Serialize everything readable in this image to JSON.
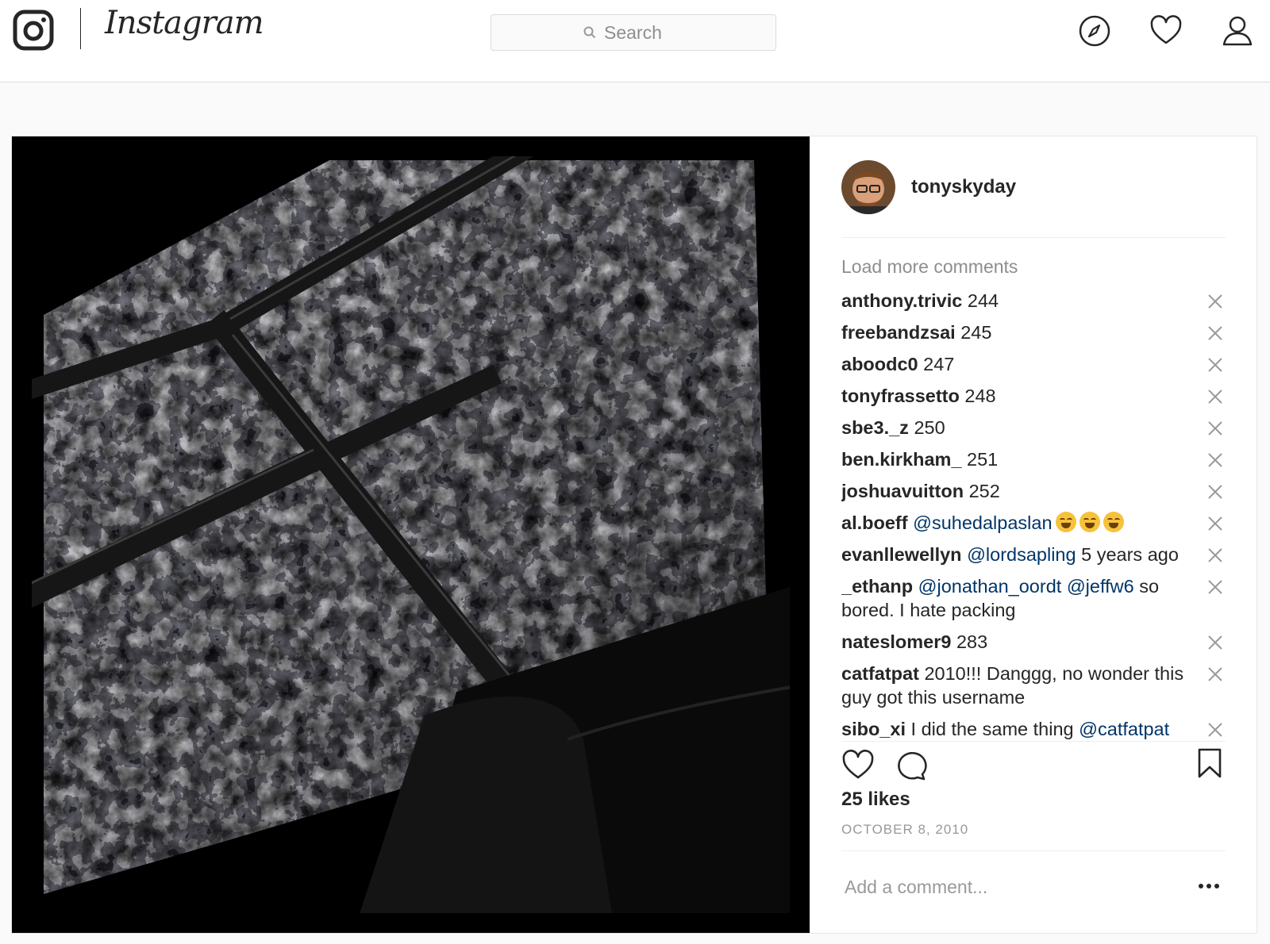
{
  "header": {
    "brand": "Instagram",
    "search_placeholder": "Search"
  },
  "post": {
    "username": "tonyskyday",
    "load_more": "Load more comments",
    "comments": [
      {
        "user": "anthony.trivic",
        "parts": [
          {
            "type": "text",
            "value": "244"
          }
        ]
      },
      {
        "user": "freebandzsai",
        "parts": [
          {
            "type": "text",
            "value": "245"
          }
        ]
      },
      {
        "user": "aboodc0",
        "parts": [
          {
            "type": "text",
            "value": "247"
          }
        ]
      },
      {
        "user": "tonyfrassetto",
        "parts": [
          {
            "type": "text",
            "value": "248"
          }
        ]
      },
      {
        "user": "sbe3._z",
        "parts": [
          {
            "type": "text",
            "value": "250"
          }
        ]
      },
      {
        "user": "ben.kirkham_",
        "parts": [
          {
            "type": "text",
            "value": "251"
          }
        ]
      },
      {
        "user": "joshuavuitton",
        "parts": [
          {
            "type": "text",
            "value": "252"
          }
        ]
      },
      {
        "user": "al.boeff",
        "parts": [
          {
            "type": "mention",
            "value": "@suhedalpaslan"
          },
          {
            "type": "emoji",
            "value": "😂"
          },
          {
            "type": "emoji",
            "value": "😂"
          },
          {
            "type": "emoji",
            "value": "😂"
          }
        ]
      },
      {
        "user": "evanllewellyn",
        "parts": [
          {
            "type": "mention",
            "value": "@lordsapling"
          },
          {
            "type": "text",
            "value": "5 years ago"
          }
        ]
      },
      {
        "user": "_ethanp",
        "parts": [
          {
            "type": "mention",
            "value": "@jonathan_oordt"
          },
          {
            "type": "mention",
            "value": "@jeffw6"
          },
          {
            "type": "text",
            "value": "so bored. I hate packing"
          }
        ]
      },
      {
        "user": "nateslomer9",
        "parts": [
          {
            "type": "text",
            "value": "283"
          }
        ]
      },
      {
        "user": "catfatpat",
        "parts": [
          {
            "type": "text",
            "value": "2010!!! Danggg, no wonder this guy got this username"
          }
        ]
      },
      {
        "user": "sibo_xi",
        "parts": [
          {
            "type": "text",
            "value": "I did the same thing"
          },
          {
            "type": "mention",
            "value": "@catfatpat"
          }
        ]
      }
    ],
    "likes": "25 likes",
    "date": "OCTOBER 8, 2010",
    "add_comment_placeholder": "Add a comment..."
  },
  "colors": {
    "mention": "#003569",
    "muted": "#8e8e8e",
    "border": "#dbdbdb"
  }
}
